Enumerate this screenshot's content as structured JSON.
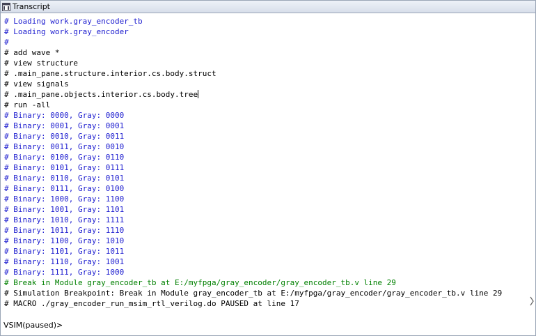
{
  "window": {
    "title": "Transcript"
  },
  "colors": {
    "info": "#2020d0",
    "break": "#008000",
    "plain": "#000000"
  },
  "transcript_lines": [
    {
      "text": "# Loading work.gray_encoder_tb",
      "kind": "info"
    },
    {
      "text": "# Loading work.gray_encoder",
      "kind": "info"
    },
    {
      "text": "#",
      "kind": "info"
    },
    {
      "text": "# add wave *",
      "kind": "plain"
    },
    {
      "text": "# view structure",
      "kind": "plain"
    },
    {
      "text": "# .main_pane.structure.interior.cs.body.struct",
      "kind": "plain"
    },
    {
      "text": "# view signals",
      "kind": "plain"
    },
    {
      "text": "# .main_pane.objects.interior.cs.body.tree",
      "kind": "plain",
      "caret": true
    },
    {
      "text": "# run -all",
      "kind": "plain"
    },
    {
      "text": "# Binary: 0000, Gray: 0000",
      "kind": "info"
    },
    {
      "text": "# Binary: 0001, Gray: 0001",
      "kind": "info"
    },
    {
      "text": "# Binary: 0010, Gray: 0011",
      "kind": "info"
    },
    {
      "text": "# Binary: 0011, Gray: 0010",
      "kind": "info"
    },
    {
      "text": "# Binary: 0100, Gray: 0110",
      "kind": "info"
    },
    {
      "text": "# Binary: 0101, Gray: 0111",
      "kind": "info"
    },
    {
      "text": "# Binary: 0110, Gray: 0101",
      "kind": "info"
    },
    {
      "text": "# Binary: 0111, Gray: 0100",
      "kind": "info"
    },
    {
      "text": "# Binary: 1000, Gray: 1100",
      "kind": "info"
    },
    {
      "text": "# Binary: 1001, Gray: 1101",
      "kind": "info"
    },
    {
      "text": "# Binary: 1010, Gray: 1111",
      "kind": "info"
    },
    {
      "text": "# Binary: 1011, Gray: 1110",
      "kind": "info"
    },
    {
      "text": "# Binary: 1100, Gray: 1010",
      "kind": "info"
    },
    {
      "text": "# Binary: 1101, Gray: 1011",
      "kind": "info"
    },
    {
      "text": "# Binary: 1110, Gray: 1001",
      "kind": "info"
    },
    {
      "text": "# Binary: 1111, Gray: 1000",
      "kind": "info"
    },
    {
      "text": "# Break in Module gray_encoder_tb at E:/myfpga/gray_encoder/gray_encoder_tb.v line 29",
      "kind": "break"
    },
    {
      "text": "# Simulation Breakpoint: Break in Module gray_encoder_tb at E:/myfpga/gray_encoder/gray_encoder_tb.v line 29",
      "kind": "plain"
    },
    {
      "text": "# MACRO ./gray_encoder_run_msim_rtl_verilog.do PAUSED at line 17",
      "kind": "plain"
    }
  ],
  "prompt": {
    "text": "VSIM(paused)>"
  },
  "icons": {
    "window": "transcript-window-icon"
  }
}
